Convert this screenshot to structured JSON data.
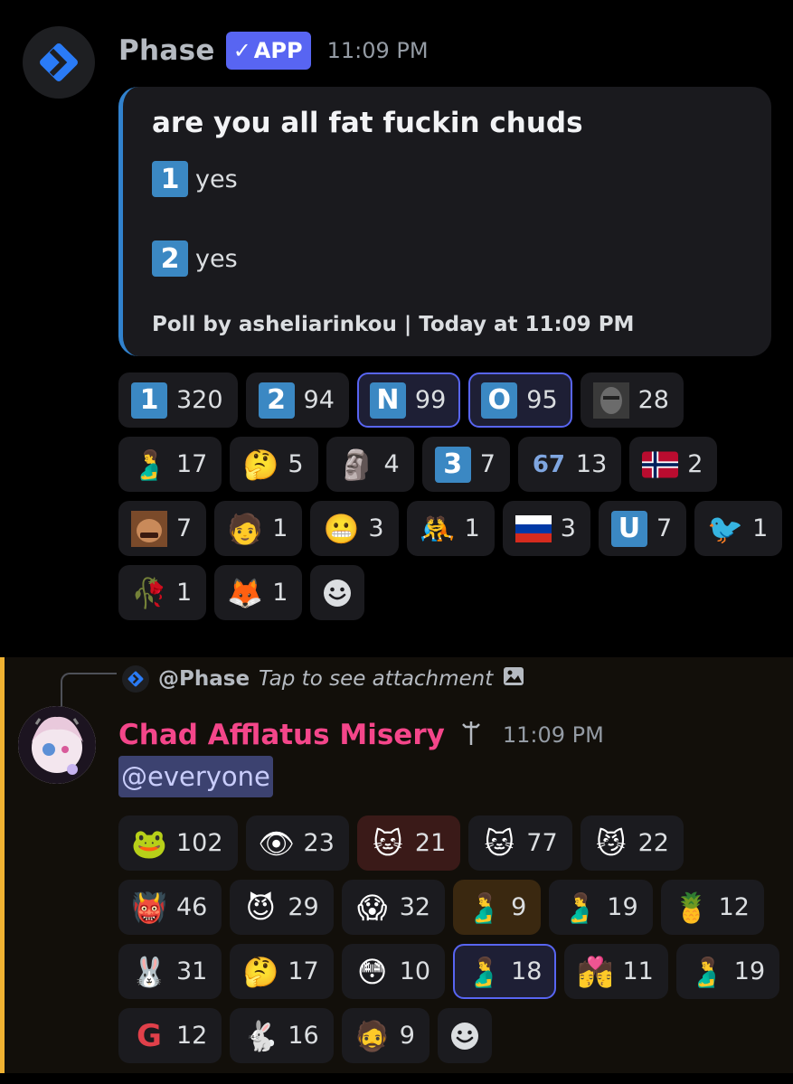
{
  "message1": {
    "username": "Phase",
    "badge_check": "✓",
    "badge": "APP",
    "time": "11:09 PM",
    "embed": {
      "title": "are you all fat fuckin chuds",
      "options": [
        {
          "num": "1",
          "text": "yes"
        },
        {
          "num": "2",
          "text": "yes"
        }
      ],
      "footer": "Poll by asheliarinkou | Today at 11:09 PM",
      "accent": "#3182ce"
    },
    "reactions": [
      [
        {
          "emoji": "keycap-1",
          "glyph": "1",
          "count": "320"
        },
        {
          "emoji": "keycap-2",
          "glyph": "2",
          "count": "94"
        },
        {
          "emoji": "letter-n",
          "glyph": "N",
          "count": "99",
          "selected": true
        },
        {
          "emoji": "letter-o",
          "glyph": "O",
          "count": "95",
          "selected": true
        },
        {
          "emoji": "face-photo-custom",
          "count": "28"
        }
      ],
      [
        {
          "emoji": "pregnant-man-emoji",
          "glyph": "🫃",
          "count": "17"
        },
        {
          "emoji": "thinking-face-emoji",
          "glyph": "🤔",
          "count": "5"
        },
        {
          "emoji": "moai-emoji",
          "glyph": "🗿",
          "count": "4"
        },
        {
          "emoji": "keycap-3",
          "glyph": "3",
          "count": "7"
        },
        {
          "emoji": "sixty-seven-custom",
          "glyph": "67",
          "count": "13"
        },
        {
          "emoji": "norway-flag-emoji",
          "count": "2"
        }
      ],
      [
        {
          "emoji": "man-face-custom",
          "count": "7"
        },
        {
          "emoji": "mario-custom",
          "glyph": "🧑",
          "count": "1"
        },
        {
          "emoji": "stewie-custom",
          "glyph": "😬",
          "count": "3"
        },
        {
          "emoji": "wrestlers-emoji",
          "glyph": "🤼",
          "count": "1"
        },
        {
          "emoji": "russia-flag-emoji",
          "count": "3"
        },
        {
          "emoji": "letter-u",
          "glyph": "U",
          "count": "7"
        },
        {
          "emoji": "bird-custom",
          "glyph": "🐦",
          "count": "1"
        }
      ],
      [
        {
          "emoji": "wilted-flower-emoji",
          "glyph": "🥀",
          "count": "1"
        },
        {
          "emoji": "anime-girl-custom",
          "glyph": "🦊",
          "count": "1"
        },
        {
          "emoji": "add-reaction-icon",
          "add": true
        }
      ]
    ]
  },
  "message2": {
    "reply": {
      "username": "@Phase",
      "text": "Tap to see attachment"
    },
    "username": "Chad Afflatus Misery",
    "role_icon": "dagger",
    "time": "11:09 PM",
    "mention": "@everyone",
    "accent": "#f0b232",
    "reactions": [
      [
        {
          "emoji": "pepe-custom",
          "glyph": "🐸",
          "count": "102"
        },
        {
          "emoji": "eye-emoji",
          "glyph": "👁",
          "count": "23"
        },
        {
          "emoji": "cat-notification-custom",
          "glyph": "🐱",
          "count": "21",
          "variant": "red"
        },
        {
          "emoji": "cat-notification-custom-2",
          "glyph": "🐱",
          "count": "77"
        },
        {
          "emoji": "cat-custom",
          "glyph": "😼",
          "count": "22"
        }
      ],
      [
        {
          "emoji": "red-eyes-custom",
          "glyph": "👹",
          "count": "46"
        },
        {
          "emoji": "glowing-eyes-custom",
          "glyph": "😈",
          "count": "29"
        },
        {
          "emoji": "screaming-custom",
          "glyph": "😱",
          "count": "32"
        },
        {
          "emoji": "pregnant-man-emoji",
          "glyph": "🫃",
          "count": "9",
          "variant": "orange"
        },
        {
          "emoji": "pregnant-man-emoji-2",
          "glyph": "🫃",
          "count": "19"
        },
        {
          "emoji": "pineapple-emoji",
          "glyph": "🍍",
          "count": "12"
        }
      ],
      [
        {
          "emoji": "bunny-notification-custom",
          "glyph": "🐰",
          "count": "31"
        },
        {
          "emoji": "thinking-face-emoji",
          "glyph": "🤔",
          "count": "17"
        },
        {
          "emoji": "googly-face-custom",
          "glyph": "😳",
          "count": "10"
        },
        {
          "emoji": "sleeping-pregnant-custom",
          "glyph": "🫃",
          "count": "18",
          "selected": true
        },
        {
          "emoji": "kiss-emoji",
          "glyph": "💏",
          "count": "11"
        },
        {
          "emoji": "pregnant-man-emoji-3",
          "glyph": "🫃",
          "count": "19"
        }
      ],
      [
        {
          "emoji": "g-logo-custom",
          "glyph": "G",
          "count": "12"
        },
        {
          "emoji": "rabbit-custom",
          "glyph": "🐇",
          "count": "16"
        },
        {
          "emoji": "bald-man-custom",
          "glyph": "🧔",
          "count": "9"
        },
        {
          "emoji": "add-reaction-icon",
          "add": true
        }
      ]
    ]
  }
}
